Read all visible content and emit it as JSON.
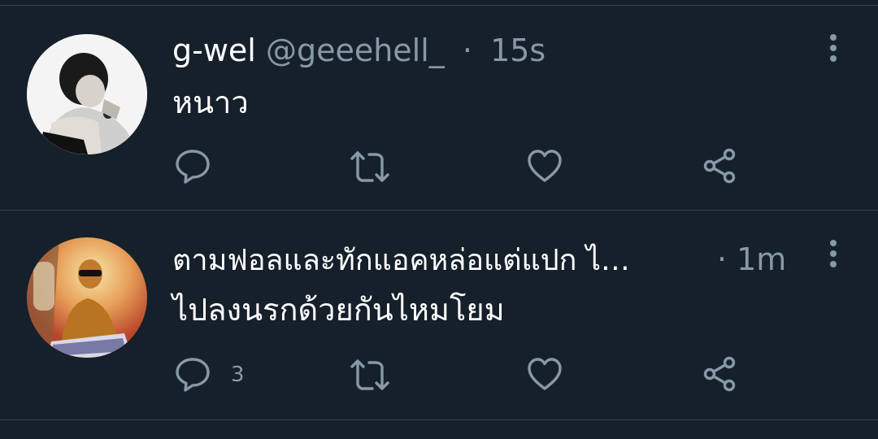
{
  "colors": {
    "background": "#15202b",
    "divider": "#38444d",
    "secondary_text": "#8899a6",
    "icon": "#8899a6"
  },
  "tweets": [
    {
      "display_name": "g-wel",
      "handle": "@geeehell_",
      "separator": "·",
      "time": "15s",
      "text": "หนาว",
      "reply_count": "",
      "icons": [
        "reply-icon",
        "retweet-icon",
        "like-icon",
        "share-icon",
        "more-icon"
      ]
    },
    {
      "display_name": "ตามฟอลและทักแอคหล่อแต่แปก ไ…",
      "separator": "·",
      "time": "1m",
      "text": "ไปลงนรกด้วยกันไหมโยม",
      "reply_count": "3",
      "icons": [
        "reply-icon",
        "retweet-icon",
        "like-icon",
        "share-icon",
        "more-icon"
      ]
    }
  ]
}
